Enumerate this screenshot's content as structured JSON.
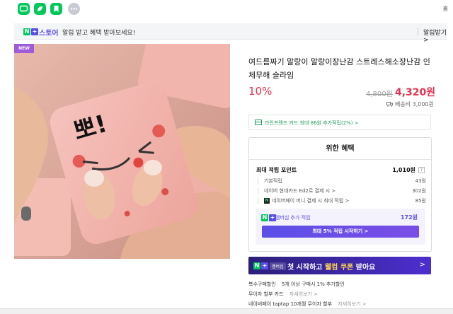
{
  "topbar": {
    "apps": [
      {
        "name": "talk-app",
        "color": "#03c75a"
      },
      {
        "name": "wallet-app",
        "color": "#03c75a"
      },
      {
        "name": "bookmark-app",
        "color": "#03c75a"
      },
      {
        "name": "more-apps",
        "color": "#c8ccd2"
      }
    ],
    "user_label": "홈"
  },
  "notice": {
    "badge_n": "N",
    "badge_plus": "+",
    "brand": "스토어",
    "message": "알림 받고 혜택 받아보세요!",
    "cta": "알림받기 >"
  },
  "product": {
    "badge": "NEW",
    "title": "여드름짜기 말랑이 말랑이장난감 스트레스해소장난감 인체무해 슬라임",
    "discount": "10%",
    "original_price": "4,800원",
    "sale_price": "4,320원",
    "shipping": "배송비 3,000원",
    "image_text": "뽀!"
  },
  "card_offer": {
    "text": "라인프렌즈 카드 최대 86원 추가적립(2%) >"
  },
  "benefit": {
    "title": "위한 혜택",
    "max_label": "최대 적립 포인트",
    "max_value": "1,010원",
    "help": "?",
    "rows": [
      {
        "label": "기본적립",
        "value": "43원"
      },
      {
        "label": "네이버 현대카드 Ed2로 결제 시 >",
        "value": "302원"
      },
      {
        "label": "네이버페이 머니 결제 시 최대 적립 >",
        "value": "85원"
      }
    ],
    "npay_badge": "N",
    "membership_label": "멤버십 추가 적립",
    "membership_value": "172원",
    "membership_button": "최대 5% 적립 시작하기 >"
  },
  "promo": {
    "badge": "멤버십",
    "text_before": "첫 시작하고 ",
    "text_highlight": "웰컴 쿠폰",
    "text_after": " 받아요",
    "arrow": ">"
  },
  "extras": [
    {
      "label": "복수구매할인",
      "value": "5개 이상 구매시 1% 추가할인",
      "more": ""
    },
    {
      "label": "무이자 할부 카드",
      "value": "",
      "more": "자세히보기 >"
    },
    {
      "label": "네이버페이 taptap 10개월 무이자 할부",
      "value": "",
      "more": "자세히보기 >"
    }
  ],
  "colors": {
    "brand_green": "#03c75a",
    "accent_purple": "#5b4ee8",
    "price_red": "#e4334f"
  }
}
